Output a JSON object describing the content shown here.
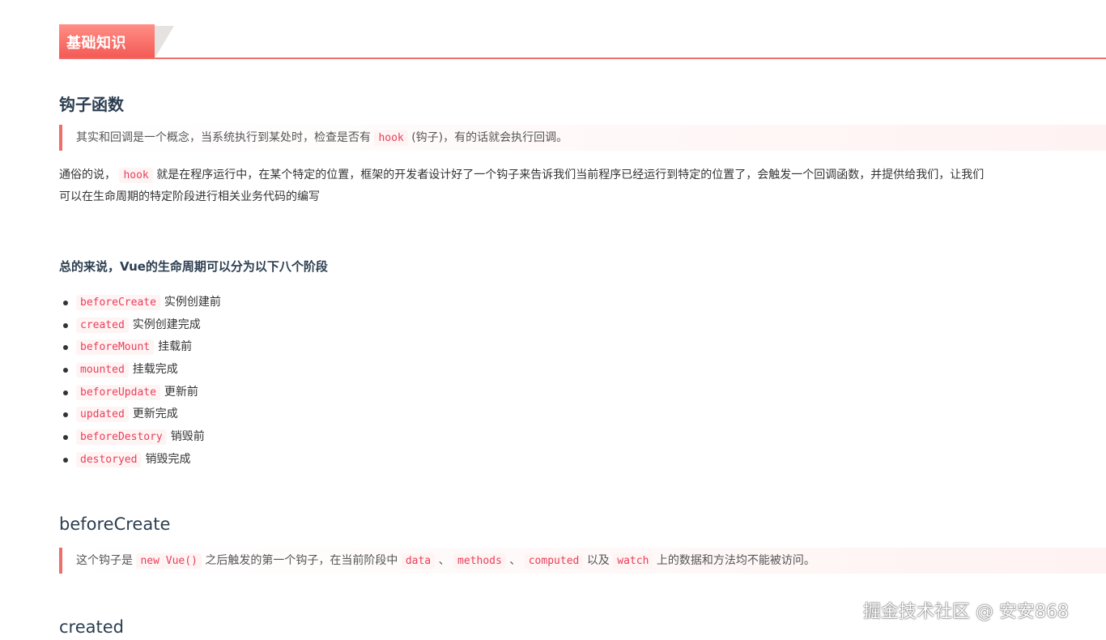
{
  "section": {
    "title": "基础知识"
  },
  "hook_section": {
    "title": "钩子函数",
    "quote": {
      "before": "其实和回调是一个概念，当系统执行到某处时，检查是否有",
      "code": "hook",
      "after": "(钩子)，有的话就会执行回调。"
    },
    "para": {
      "line1_before": "通俗的说，",
      "code": "hook",
      "line1_after": "就是在程序运行中，在某个特定的位置，框架的开发者设计好了一个钩子来告诉我们当前程序已经运行到特定的位置了，会触发一个回调函数，并提供给我们，让我们",
      "line2": "可以在生命周期的特定阶段进行相关业务代码的编写"
    }
  },
  "summary_title": "总的来说，Vue的生命周期可以分为以下八个阶段",
  "lifecycle": [
    {
      "code": "beforeCreate",
      "desc": "实例创建前"
    },
    {
      "code": "created",
      "desc": "实例创建完成"
    },
    {
      "code": "beforeMount",
      "desc": "挂载前"
    },
    {
      "code": "mounted",
      "desc": "挂载完成"
    },
    {
      "code": "beforeUpdate",
      "desc": "更新前"
    },
    {
      "code": "updated",
      "desc": "更新完成"
    },
    {
      "code": "beforeDestory",
      "desc": "销毁前"
    },
    {
      "code": "destoryed",
      "desc": "销毁完成"
    }
  ],
  "before_create_section": {
    "title": "beforeCreate",
    "quote": {
      "p1": "这个钩子是",
      "c1": "new Vue()",
      "p2": "之后触发的第一个钩子，在当前阶段中",
      "c2": "data",
      "p3": "、",
      "c3": "methods",
      "p4": "、",
      "c4": "computed",
      "p5": "以及",
      "c5": "watch",
      "p6": "上的数据和方法均不能被访问。"
    }
  },
  "created_section": {
    "title": "created"
  },
  "watermark": "掘金技术社区 @ 安安868"
}
